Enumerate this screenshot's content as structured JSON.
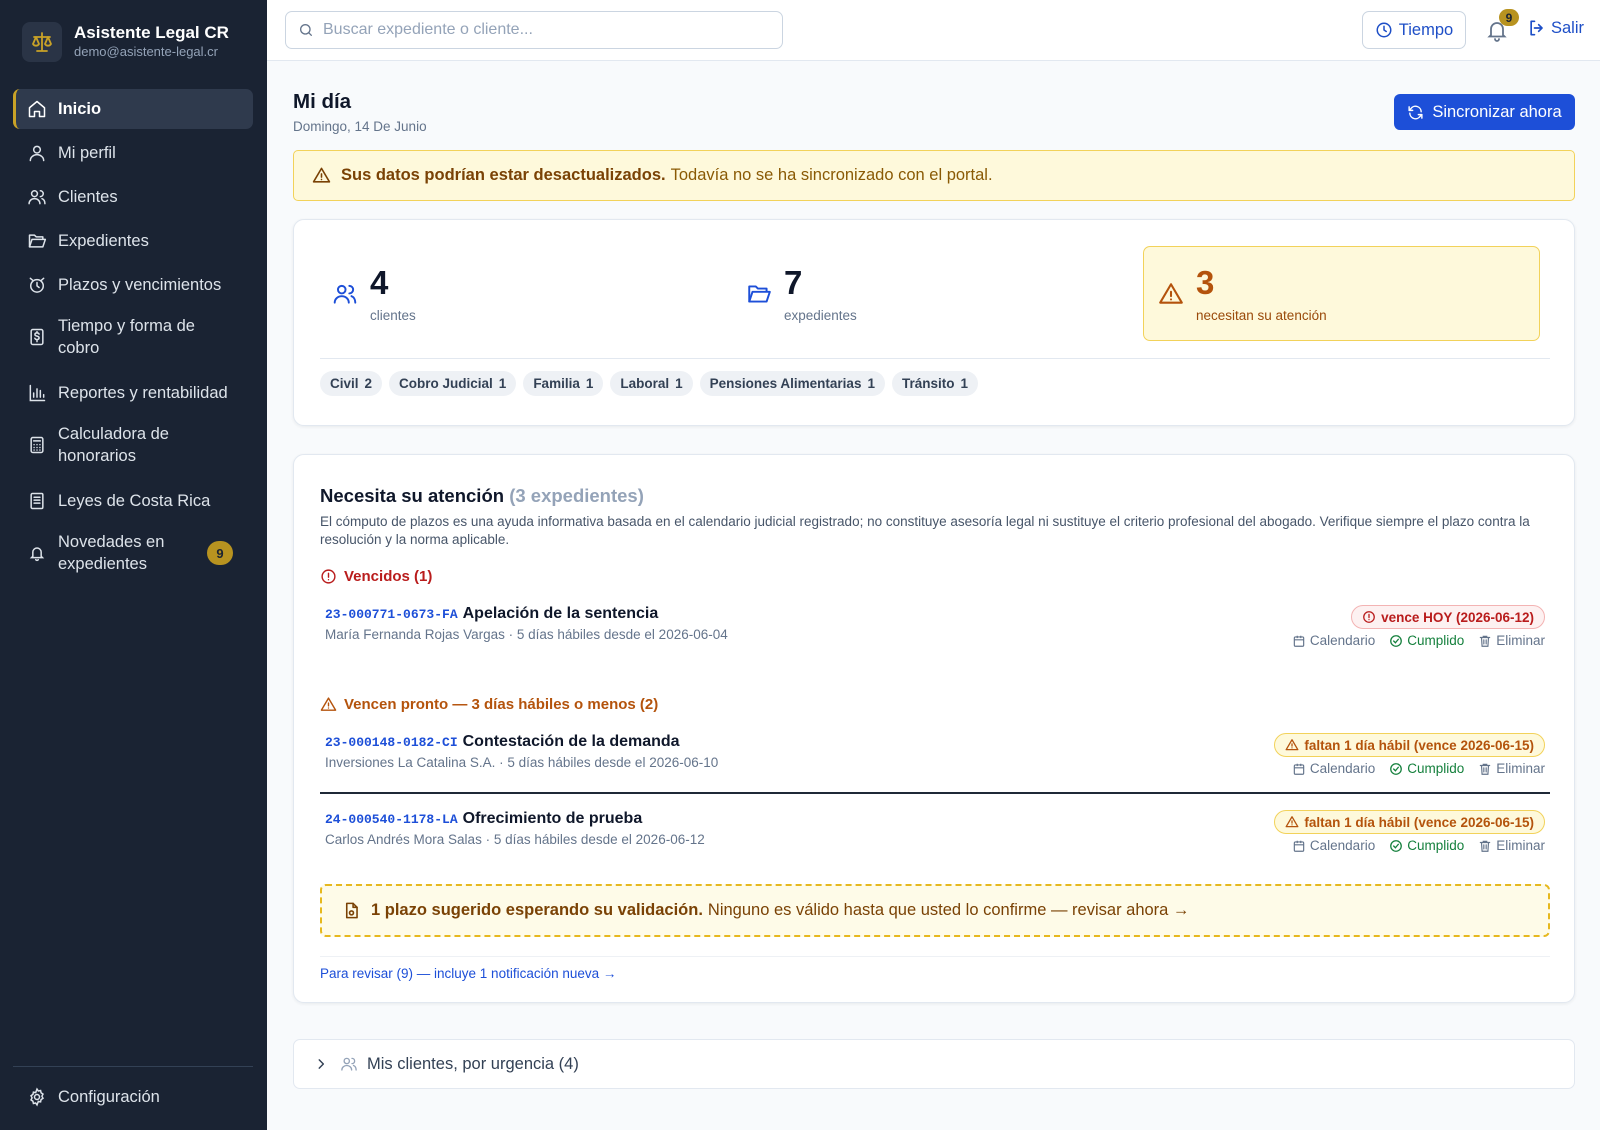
{
  "brand": {
    "name": "Asistente Legal CR",
    "email": "demo@asistente-legal.cr"
  },
  "sidebar": {
    "items": [
      {
        "label": "Inicio",
        "icon": "home-icon"
      },
      {
        "label": "Mi perfil",
        "icon": "user-icon"
      },
      {
        "label": "Clientes",
        "icon": "users-icon"
      },
      {
        "label": "Expedientes",
        "icon": "folder-open-icon"
      },
      {
        "label": "Plazos y vencimientos",
        "icon": "alarm-clock-icon"
      },
      {
        "label": "Tiempo y forma de cobro",
        "icon": "receipt-icon"
      },
      {
        "label": "Reportes y rentabilidad",
        "icon": "bar-chart-icon"
      },
      {
        "label": "Calculadora de honorarios",
        "icon": "calculator-icon"
      },
      {
        "label": "Leyes de Costa Rica",
        "icon": "book-icon"
      },
      {
        "label": "Novedades en expedientes",
        "icon": "bell-icon",
        "badge": "9"
      }
    ],
    "config_label": "Configuración"
  },
  "topbar": {
    "search_placeholder": "Buscar expediente o cliente...",
    "tiempo_label": "Tiempo",
    "notifications_count": "9",
    "salir_label": "Salir"
  },
  "page": {
    "title": "Mi día",
    "date": "Domingo, 14 De Junio",
    "sync_label": "Sincronizar ahora"
  },
  "alert": {
    "bold": "Sus datos podrían estar desactualizados.",
    "text": "Todavía no se ha sincronizado con el portal."
  },
  "stats": {
    "clientes": {
      "value": "4",
      "caption": "clientes"
    },
    "expedientes": {
      "value": "7",
      "caption": "expedientes"
    },
    "atencion": {
      "value": "3",
      "caption": "necesitan su atención"
    },
    "chips": [
      {
        "label": "Civil",
        "count": "2"
      },
      {
        "label": "Cobro Judicial",
        "count": "1"
      },
      {
        "label": "Familia",
        "count": "1"
      },
      {
        "label": "Laboral",
        "count": "1"
      },
      {
        "label": "Pensiones Alimentarias",
        "count": "1"
      },
      {
        "label": "Tránsito",
        "count": "1"
      }
    ]
  },
  "attention": {
    "title": "Necesita su atención",
    "count_label": "(3 expedientes)",
    "description": "El cómputo de plazos es una ayuda informativa basada en el calendario judicial registrado; no constituye asesoría legal ni sustituye el criterio profesional del abogado. Verifique siempre el plazo contra la resolución y la norma aplicable.",
    "overdue_header": "Vencidos (1)",
    "soon_header": "Vencen pronto — 3 días hábiles o menos (2)",
    "actions": {
      "calendar": "Calendario",
      "done": "Cumplido",
      "delete": "Eliminar"
    },
    "items": [
      {
        "code": "23-000771-0673-FA",
        "title": "Apelación de la sentencia",
        "sub": "María Fernanda Rojas Vargas · 5 días hábiles desde el 2026-06-04",
        "pill": "vence HOY (2026-06-12)",
        "status": "overdue"
      },
      {
        "code": "23-000148-0182-CI",
        "title": "Contestación de la demanda",
        "sub": "Inversiones La Catalina S.A. · 5 días hábiles desde el 2026-06-10",
        "pill": "faltan 1 día hábil (vence 2026-06-15)",
        "status": "soon"
      },
      {
        "code": "24-000540-1178-LA",
        "title": "Ofrecimiento de prueba",
        "sub": "Carlos Andrés Mora Salas · 5 días hábiles desde el 2026-06-12",
        "pill": "faltan 1 día hábil (vence 2026-06-15)",
        "status": "soon"
      }
    ],
    "suggestion_bold": "1 plazo sugerido esperando su validación.",
    "suggestion_text": "Ninguno es válido hasta que usted lo confirme — revisar ahora →",
    "review_link": "Para revisar (9) — incluye 1 notificación nueva →"
  },
  "clients_section": {
    "label": "Mis clientes, por urgencia (4)"
  },
  "colors": {
    "sidebar_bg": "#1a2333",
    "accent_blue": "#1d4fd8",
    "accent_gold": "#c9a227",
    "warning_amber": "#b4530c",
    "danger_red": "#b91c1c",
    "success_green": "#15803d"
  }
}
